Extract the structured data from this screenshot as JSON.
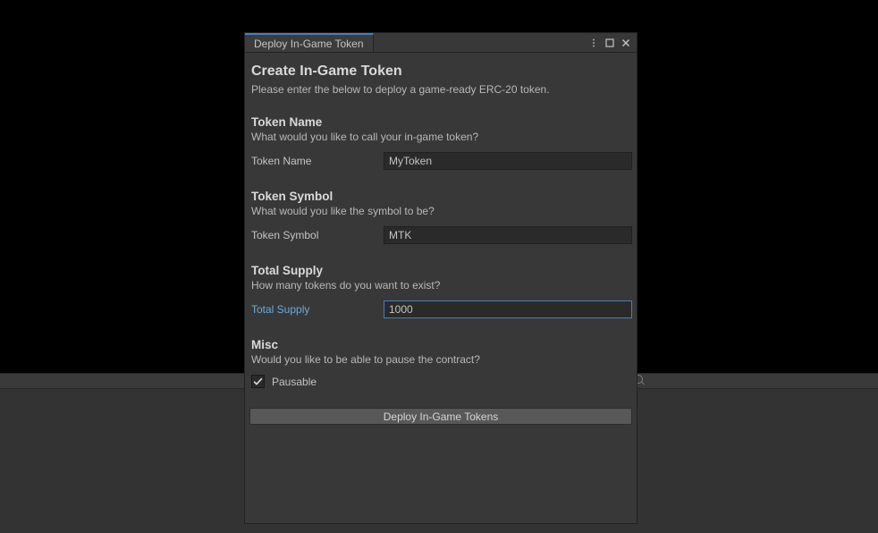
{
  "window": {
    "tab_title": "Deploy In-Game Token"
  },
  "header": {
    "title": "Create In-Game Token",
    "subtitle": "Please enter the below to deploy a game-ready ERC-20 token."
  },
  "sections": {
    "token_name": {
      "heading": "Token Name",
      "desc": "What would you like to call your in-game token?",
      "field_label": "Token Name",
      "field_value": "MyToken"
    },
    "token_symbol": {
      "heading": "Token Symbol",
      "desc": "What would you like the symbol to be?",
      "field_label": "Token Symbol",
      "field_value": "MTK"
    },
    "total_supply": {
      "heading": "Total Supply",
      "desc": "How many tokens do you want to exist?",
      "field_label": "Total Supply",
      "field_value": "1000"
    },
    "misc": {
      "heading": "Misc",
      "desc": "Would you like to be able to pause the contract?",
      "checkbox_label": "Pausable",
      "checkbox_checked": true
    }
  },
  "actions": {
    "deploy_label": "Deploy In-Game Tokens"
  }
}
